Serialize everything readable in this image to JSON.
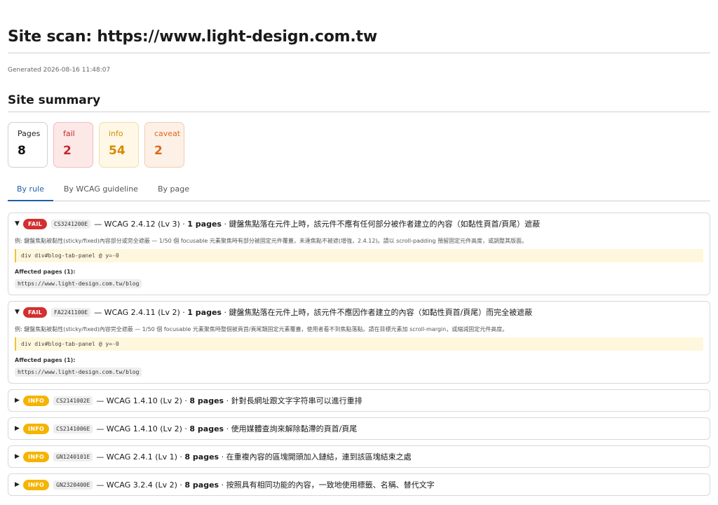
{
  "page": {
    "title": "Site scan: https://www.light-design.com.tw",
    "generated": "Generated 2026-08-16 11:48:07"
  },
  "summary": {
    "heading": "Site summary",
    "cards": [
      {
        "label": "Pages",
        "value": "8"
      },
      {
        "label": "fail",
        "value": "2"
      },
      {
        "label": "info",
        "value": "54"
      },
      {
        "label": "caveat",
        "value": "2"
      }
    ]
  },
  "tabs": [
    "By rule",
    "By WCAG guideline",
    "By page"
  ],
  "rules": [
    {
      "badge": "FAIL",
      "code": "CS3241200E",
      "wcag": "— WCAG 2.4.12 (Lv 3) ·",
      "pages": "1 pages",
      "desc": "· 鍵盤焦點落在元件上時，該元件不應有任何部分被作者建立的內容（如黏性頁首/頁尾）遮蔽",
      "example": "例: 鍵盤焦點被黏性(sticky/fixed)內容部分或完全遮蔽 — 1/50 個 focusable 元素聚焦時有部分被固定元件覆蓋，未達焦點不被遮(增強，2.4.12)。請以 scroll-padding 預留固定元件高度，或調整其版面。",
      "selector": "div div#blog-tab-panel @ y=-0",
      "affected_label": "Affected pages (1):",
      "affected_url": "https://www.light-design.com.tw/blog"
    },
    {
      "badge": "FAIL",
      "code": "FA2241100E",
      "wcag": "— WCAG 2.4.11 (Lv 2) ·",
      "pages": "1 pages",
      "desc": "· 鍵盤焦點落在元件上時，該元件不應因作者建立的內容（如黏性頁首/頁尾）而完全被遮蔽",
      "example": "例: 鍵盤焦點被黏性(sticky/fixed)內容完全遮蔽 — 1/50 個 focusable 元素聚焦時整個被頁首/頁尾類固定元素覆蓋，使用者看不到焦點落點。請在目標元素加 scroll-margin，或縮減固定元件高度。",
      "selector": "div div#blog-tab-panel @ y=-0",
      "affected_label": "Affected pages (1):",
      "affected_url": "https://www.light-design.com.tw/blog"
    },
    {
      "badge": "INFO",
      "code": "CS2141002E",
      "wcag": "— WCAG 1.4.10 (Lv 2) ·",
      "pages": "8 pages",
      "desc": "· 針對長網址跟文字字符串可以進行重排"
    },
    {
      "badge": "INFO",
      "code": "CS2141006E",
      "wcag": "— WCAG 1.4.10 (Lv 2) ·",
      "pages": "8 pages",
      "desc": "· 使用媒體查詢來解除黏滯的頁首/頁尾"
    },
    {
      "badge": "INFO",
      "code": "GN1240101E",
      "wcag": "— WCAG 2.4.1 (Lv 1) ·",
      "pages": "8 pages",
      "desc": "· 在重複內容的區塊開頭加入鏈結，連到該區塊結束之處"
    },
    {
      "badge": "INFO",
      "code": "GN2320400E",
      "wcag": "— WCAG 3.2.4 (Lv 2) ·",
      "pages": "8 pages",
      "desc": "· 按照具有相同功能的內容，一致地使用標籤、名稱、替代文字"
    }
  ],
  "colors": {
    "accent": "#1f5fa8",
    "fail": "#d32f2f",
    "info": "#f5b400",
    "caveat": "#d96a1a"
  },
  "icons": {
    "expanded": "triangle-down-icon",
    "collapsed": "triangle-right-icon"
  }
}
